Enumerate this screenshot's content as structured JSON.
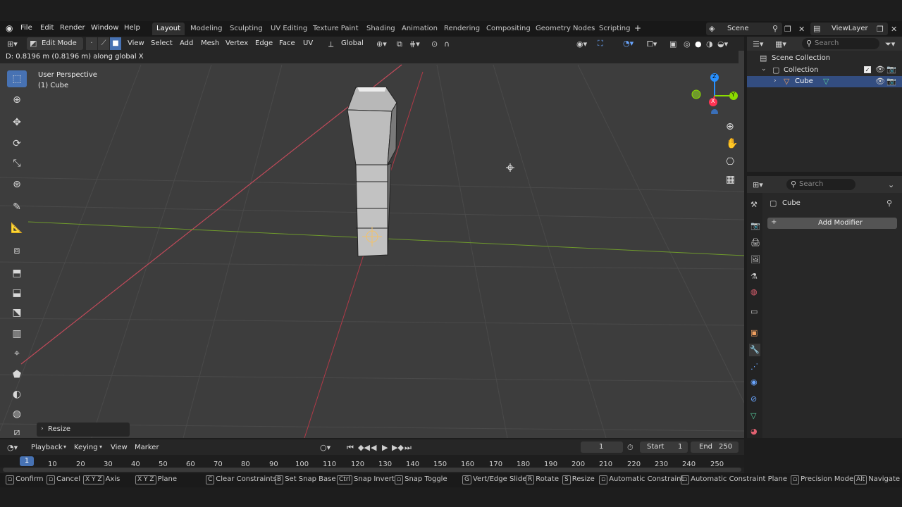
{
  "menu": {
    "file": "File",
    "edit": "Edit",
    "render": "Render",
    "window": "Window",
    "help": "Help"
  },
  "workspace_tabs": [
    "Layout",
    "Modeling",
    "Sculpting",
    "UV Editing",
    "Texture Paint",
    "Shading",
    "Animation",
    "Rendering",
    "Compositing",
    "Geometry Nodes",
    "Scripting"
  ],
  "active_tab": "Layout",
  "scene": "Scene",
  "view_layer": "ViewLayer",
  "header": {
    "mode": "Edit Mode",
    "view": "View",
    "select": "Select",
    "add": "Add",
    "mesh": "Mesh",
    "vertex": "Vertex",
    "edge": "Edge",
    "face": "Face",
    "uv": "UV",
    "orientation": "Global"
  },
  "status_msg": "D: 0.8196 m (0.8196 m) along global X",
  "viewport": {
    "perspective": "User Perspective",
    "object": "(1) Cube",
    "resize_panel": "Resize"
  },
  "gizmo": {
    "z": "Z",
    "y": "Y",
    "x": "X"
  },
  "outliner": {
    "search_placeholder": "Search",
    "scene_collection": "Scene Collection",
    "collection": "Collection",
    "cube": "Cube"
  },
  "properties": {
    "search_placeholder": "Search",
    "object": "Cube",
    "add_modifier": "Add Modifier"
  },
  "timeline": {
    "playback": "Playback",
    "keying": "Keying",
    "view": "View",
    "marker": "Marker",
    "current_frame": "1",
    "start_label": "Start",
    "start": "1",
    "end_label": "End",
    "end": "250",
    "frames": [
      "10",
      "20",
      "30",
      "40",
      "50",
      "60",
      "70",
      "80",
      "90",
      "100",
      "110",
      "120",
      "130",
      "140",
      "150",
      "160",
      "170",
      "180",
      "190",
      "200",
      "210",
      "220",
      "230",
      "240",
      "250"
    ]
  },
  "statusbar": [
    {
      "key": "",
      "label": "Confirm"
    },
    {
      "key": "",
      "label": "Cancel"
    },
    {
      "key": "X Y Z",
      "label": "Axis"
    },
    {
      "key": "X Y Z",
      "label": "Plane"
    },
    {
      "key": "C",
      "label": "Clear Constraints"
    },
    {
      "key": "B",
      "label": "Set Snap Base"
    },
    {
      "key": "Ctrl",
      "label": "Snap Invert"
    },
    {
      "key": "",
      "label": "Snap Toggle"
    },
    {
      "key": "G",
      "label": "Vert/Edge Slide"
    },
    {
      "key": "R",
      "label": "Rotate"
    },
    {
      "key": "S",
      "label": "Resize"
    },
    {
      "key": "",
      "label": "Automatic Constraint"
    },
    {
      "key": "",
      "label": "Automatic Constraint Plane"
    },
    {
      "key": "",
      "label": "Precision Mode"
    },
    {
      "key": "Alt",
      "label": "Navigate"
    }
  ],
  "colors": {
    "accent": "#4772b3",
    "x_axis": "#ff3352",
    "y_axis": "#8bdc00",
    "z_axis": "#2890ff"
  }
}
